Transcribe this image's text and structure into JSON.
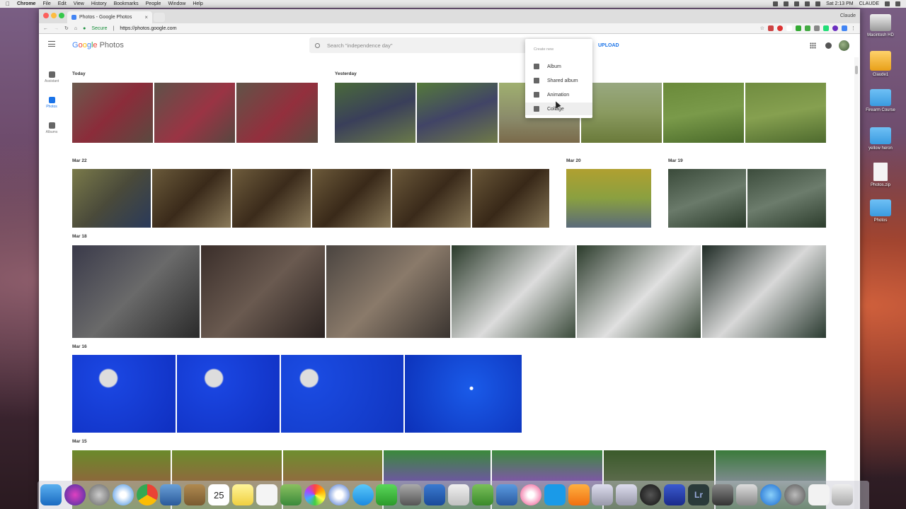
{
  "menubar": {
    "app": "Chrome",
    "items": [
      "File",
      "Edit",
      "View",
      "History",
      "Bookmarks",
      "People",
      "Window",
      "Help"
    ],
    "clock": "Sat 2:13 PM",
    "user": "CLAUDE"
  },
  "browser": {
    "tab_title": "Photos - Google Photos",
    "tab_close": "×",
    "secure_label": "Secure",
    "url": "https://photos.google.com",
    "profile": "Claude"
  },
  "photos": {
    "logo_google": [
      "G",
      "o",
      "o",
      "g",
      "l",
      "e"
    ],
    "logo_suffix": "Photos",
    "search_placeholder": "Search \"independence day\"",
    "upload_label": "UPLOAD",
    "nav": [
      {
        "label": "Assistant"
      },
      {
        "label": "Photos"
      },
      {
        "label": "Albums"
      }
    ],
    "create_menu": {
      "header": "Create new",
      "items": [
        "Album",
        "Shared album",
        "Animation",
        "Collage"
      ]
    },
    "sections": {
      "today": "Today",
      "yesterday": "Yesterday",
      "mar22": "Mar 22",
      "mar20": "Mar 20",
      "mar19": "Mar 19",
      "mar18": "Mar 18",
      "mar16": "Mar 16",
      "mar15": "Mar 15"
    }
  },
  "desktop_icons": [
    "Macintosh HD",
    "Claude1",
    "Firearm Course",
    "yellow heron",
    "Photos.zip",
    "Photos"
  ],
  "dock": {
    "calendar_day": "25",
    "lightroom": "Lr"
  },
  "colors": {
    "accent": "#1a73e8",
    "chrome_frame": "#dedede",
    "folder": "#3a9be0"
  }
}
